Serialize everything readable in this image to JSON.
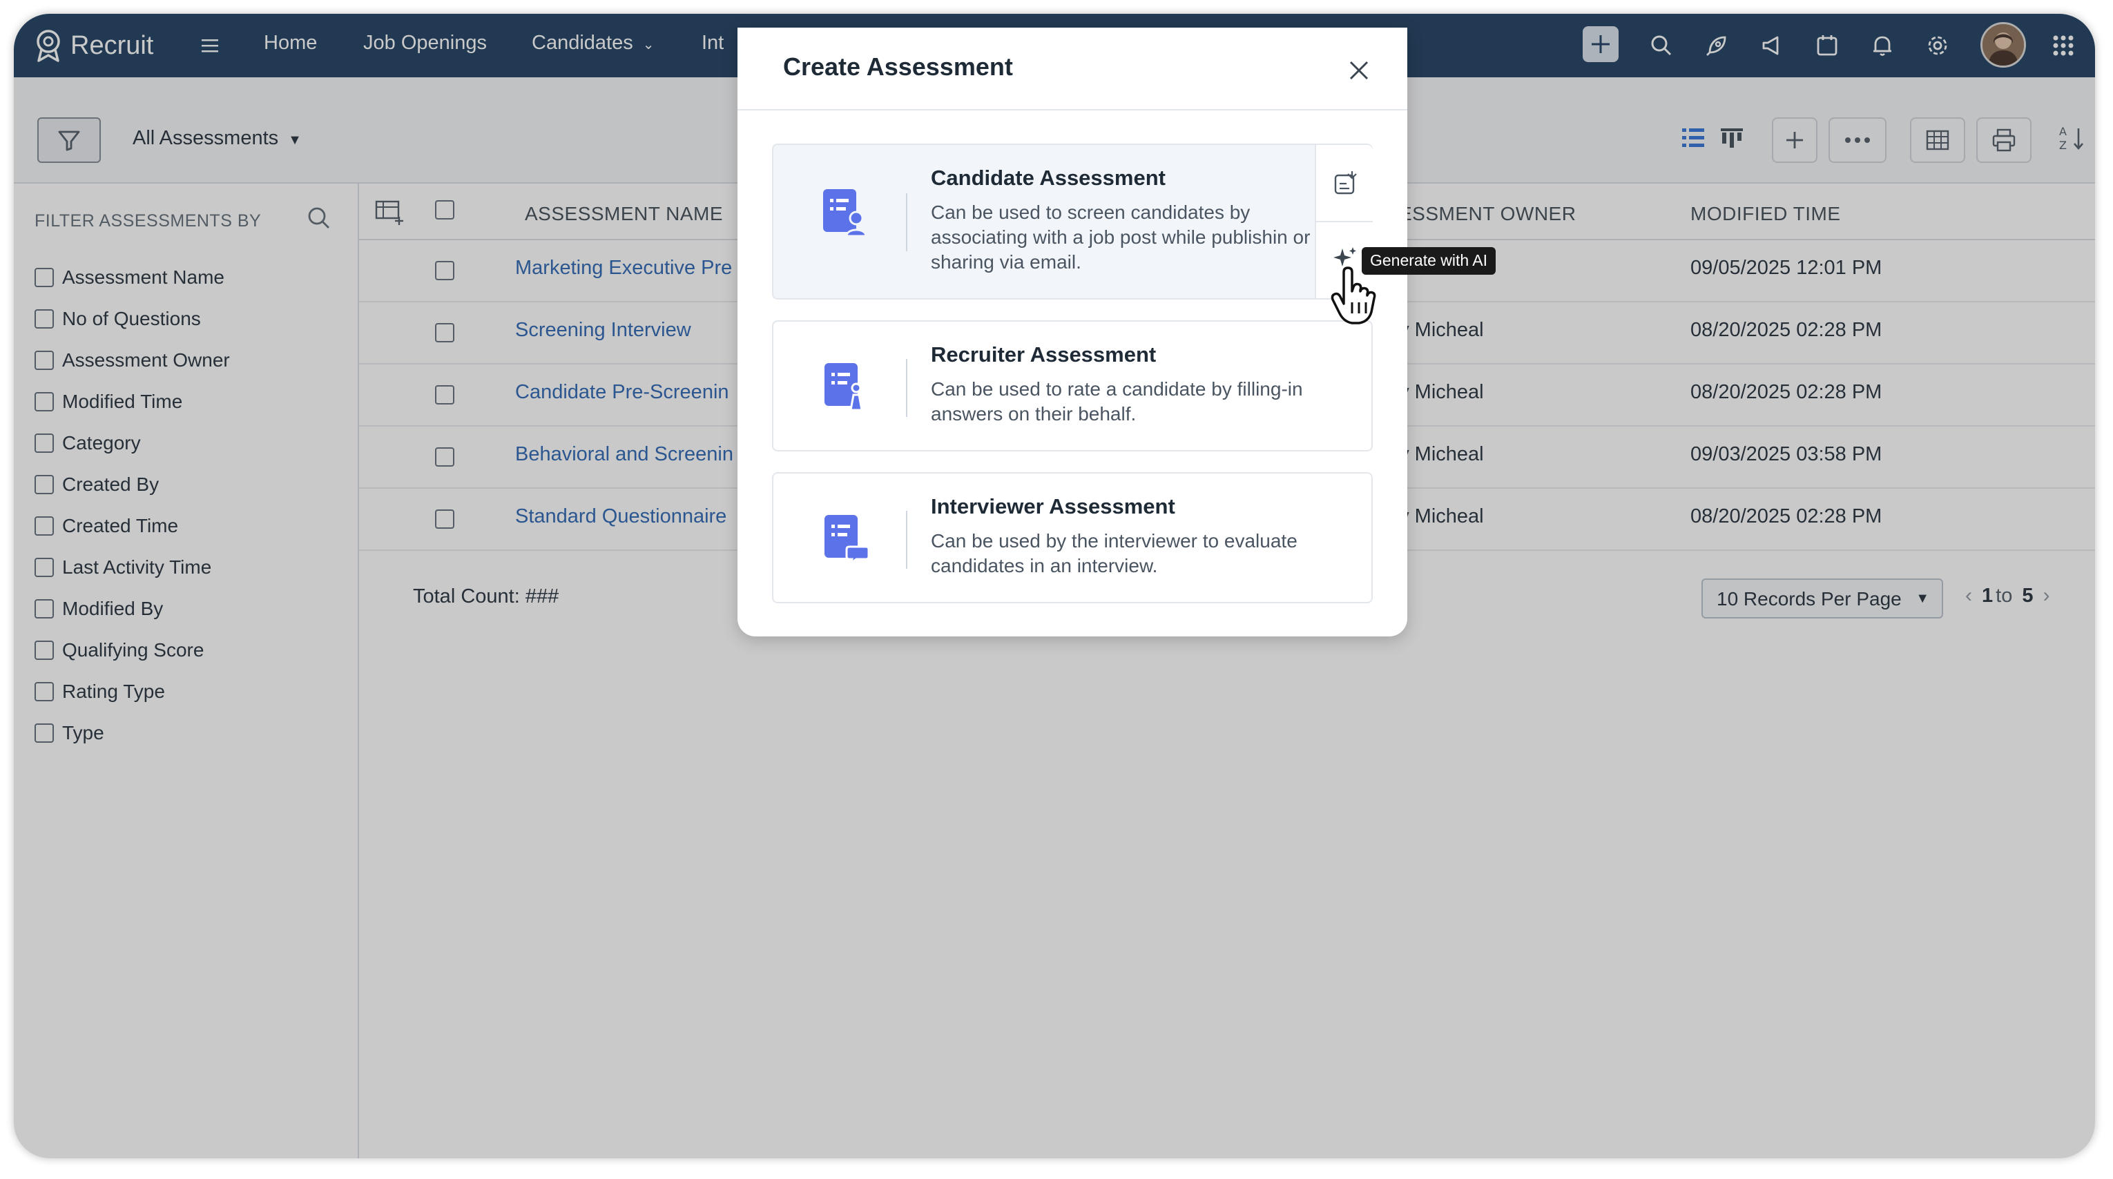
{
  "nav": {
    "logo_text": "Recruit",
    "items": [
      "Home",
      "Job Openings",
      "Candidates",
      "Int"
    ]
  },
  "toolbar": {
    "view_label": "All Assessments"
  },
  "sidebar": {
    "title": "FILTER ASSESSMENTS BY",
    "filters": [
      "Assessment Name",
      "No of Questions",
      "Assessment Owner",
      "Modified Time",
      "Category",
      "Created By",
      "Created Time",
      "Last Activity Time",
      "Modified By",
      "Qualifying Score",
      "Rating Type",
      "Type"
    ]
  },
  "table": {
    "columns": [
      "ASSESSMENT NAME",
      "ESSMENT OWNER",
      "MODIFIED TIME"
    ],
    "rows": [
      {
        "name": "Marketing Executive Pre",
        "owner": "",
        "time": "09/05/2025 12:01 PM"
      },
      {
        "name": "Screening Interview",
        "owner": "ey Micheal",
        "time": "08/20/2025 02:28 PM"
      },
      {
        "name": "Candidate Pre-Screenin",
        "owner": "ey Micheal",
        "time": "08/20/2025 02:28 PM"
      },
      {
        "name": "Behavioral and Screenin",
        "owner": "ey Micheal",
        "time": "09/03/2025 03:58 PM"
      },
      {
        "name": "Standard Questionnaire",
        "owner": "ey Micheal",
        "time": "08/20/2025 02:28 PM"
      }
    ],
    "total_count": "Total Count: ###",
    "per_page": "10 Records Per Page",
    "pager_from": "1",
    "pager_to_word": "to",
    "pager_to": "5"
  },
  "modal": {
    "title": "Create Assessment",
    "cards": [
      {
        "title": "Candidate Assessment",
        "desc": "Can be used to screen candidates by associating with a job post while publishin or sharing via email."
      },
      {
        "title": "Recruiter Assessment",
        "desc": "Can be used to rate a candidate by filling-in answers on their behalf."
      },
      {
        "title": "Interviewer Assessment",
        "desc": "Can be used by the interviewer to evaluate candidates in an interview."
      }
    ],
    "tooltip": "Generate with AI"
  },
  "colors": {
    "nav_bg": "#17385a",
    "link": "#2560b0",
    "icon_accent": "#5b72e8"
  }
}
